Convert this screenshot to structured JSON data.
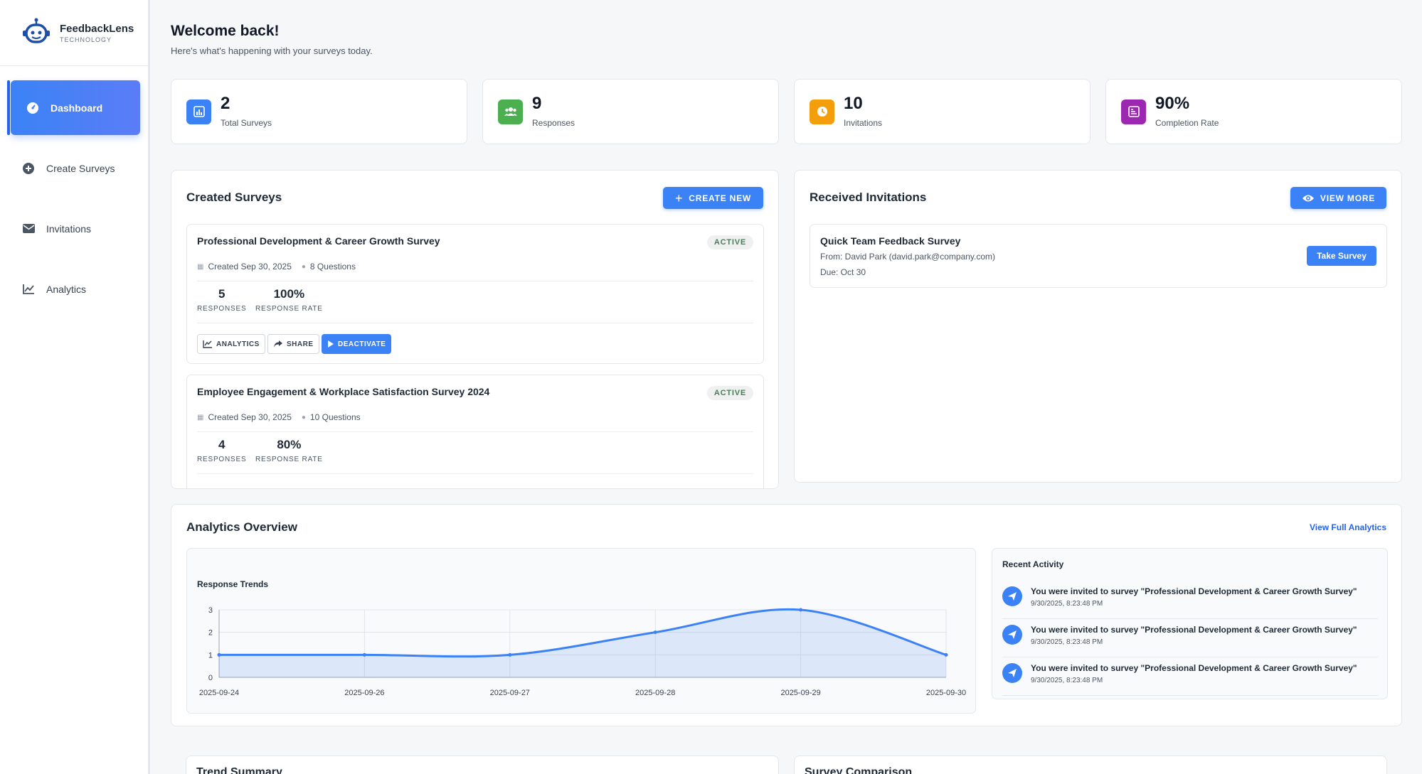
{
  "brand": {
    "name": "FeedbackLens",
    "sub": "TECHNOLOGY"
  },
  "nav": [
    {
      "label": "Dashboard"
    },
    {
      "label": "Create Surveys"
    },
    {
      "label": "Invitations"
    },
    {
      "label": "Analytics"
    }
  ],
  "header": {
    "title": "Welcome back!",
    "subtitle": "Here's what's happening with your surveys today."
  },
  "stats": [
    {
      "value": "2",
      "label": "Total Surveys",
      "color": "#3b82f6"
    },
    {
      "value": "9",
      "label": "Responses",
      "color": "#4caf50"
    },
    {
      "value": "10",
      "label": "Invitations",
      "color": "#f59e0b"
    },
    {
      "value": "90%",
      "label": "Completion Rate",
      "color": "#9c27b0"
    }
  ],
  "created": {
    "title": "Created Surveys",
    "button": "CREATE NEW",
    "surveys": [
      {
        "name": "Professional Development & Career Growth Survey",
        "status": "ACTIVE",
        "created": "Created Sep 30, 2025",
        "questions": "8 Questions",
        "responses": "5",
        "responses_label": "RESPONSES",
        "rate": "100%",
        "rate_label": "RESPONSE RATE",
        "actions": [
          "ANALYTICS",
          "SHARE",
          "DEACTIVATE"
        ]
      },
      {
        "name": "Employee Engagement & Workplace Satisfaction Survey 2024",
        "status": "ACTIVE",
        "created": "Created Sep 30, 2025",
        "questions": "10 Questions",
        "responses": "4",
        "responses_label": "RESPONSES",
        "rate": "80%",
        "rate_label": "RESPONSE RATE"
      }
    ]
  },
  "received": {
    "title": "Received Invitations",
    "button": "VIEW MORE",
    "invite": {
      "title": "Quick Team Feedback Survey",
      "from": "From: David Park (david.park@company.com)",
      "due": "Due: Oct 30",
      "button": "Take Survey"
    }
  },
  "analytics": {
    "title": "Analytics Overview",
    "link": "View Full Analytics",
    "activity_title": "Recent Activity",
    "activity": [
      {
        "text": "You were invited to survey \"Professional Development & Career Growth Survey\"",
        "time": "9/30/2025, 8:23:48 PM"
      },
      {
        "text": "You were invited to survey \"Professional Development & Career Growth Survey\"",
        "time": "9/30/2025, 8:23:48 PM"
      },
      {
        "text": "You were invited to survey \"Professional Development & Career Growth Survey\"",
        "time": "9/30/2025, 8:23:48 PM"
      }
    ]
  },
  "chart_data": {
    "type": "area",
    "title": "Response Trends",
    "categories": [
      "2025-09-24",
      "2025-09-26",
      "2025-09-27",
      "2025-09-28",
      "2025-09-29",
      "2025-09-30"
    ],
    "series": [
      {
        "values": [
          1,
          1,
          1,
          2,
          3,
          1
        ]
      }
    ],
    "ylim": [
      0,
      3
    ],
    "yticks": [
      "0",
      "1",
      "2",
      "3"
    ],
    "grid": true,
    "color": "#3b82f6"
  },
  "bottom": {
    "left_title": "Trend Summary",
    "right_title": "Survey Comparison"
  }
}
